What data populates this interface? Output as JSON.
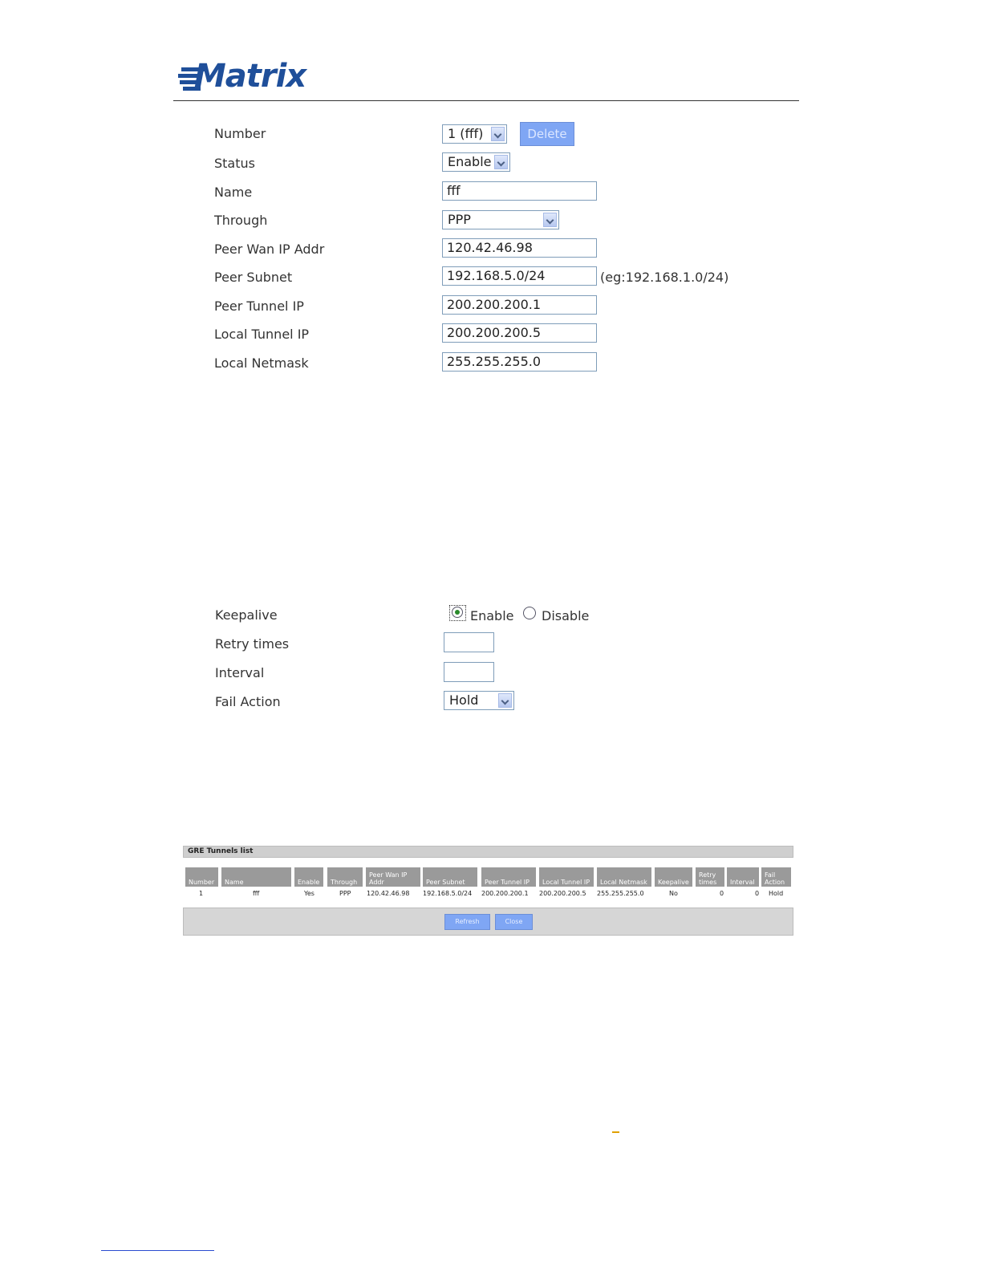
{
  "brand": {
    "logo_text": "Matrix"
  },
  "form": {
    "number": {
      "label": "Number",
      "value": "1 (fff)",
      "delete_label": "Delete"
    },
    "status": {
      "label": "Status",
      "value": "Enable"
    },
    "name": {
      "label": "Name",
      "value": "fff"
    },
    "through": {
      "label": "Through",
      "value": "PPP"
    },
    "peer_wan_ip": {
      "label": "Peer Wan IP Addr",
      "value": "120.42.46.98"
    },
    "peer_subnet": {
      "label": "Peer Subnet",
      "value": "192.168.5.0/24",
      "hint": "(eg:192.168.1.0/24)"
    },
    "peer_tunnel_ip": {
      "label": "Peer Tunnel IP",
      "value": "200.200.200.1"
    },
    "local_tunnel_ip": {
      "label": "Local Tunnel IP",
      "value": "200.200.200.5"
    },
    "local_netmask": {
      "label": "Local Netmask",
      "value": "255.255.255.0"
    }
  },
  "keepalive": {
    "label": "Keepalive",
    "enable_label": "Enable",
    "disable_label": "Disable",
    "selected": "Enable",
    "retry": {
      "label": "Retry times",
      "value": ""
    },
    "interval": {
      "label": "Interval",
      "value": ""
    },
    "fail_action": {
      "label": "Fail Action",
      "value": "Hold"
    }
  },
  "tunnels_list": {
    "title": "GRE Tunnels list",
    "columns": [
      "Number",
      "Name",
      "Enable",
      "Through",
      "Peer Wan IP Addr",
      "Peer Subnet",
      "Peer Tunnel IP",
      "Local Tunnel IP",
      "Local Netmask",
      "Keepalive",
      "Retry times",
      "Interval",
      "Fail Action"
    ],
    "rows": [
      [
        "1",
        "fff",
        "Yes",
        "PPP",
        "120.42.46.98",
        "192.168.5.0/24",
        "200.200.200.1",
        "200.200.200.5",
        "255.255.255.0",
        "No",
        "0",
        "0",
        "Hold"
      ]
    ],
    "refresh_label": "Refresh",
    "close_label": "Close"
  }
}
